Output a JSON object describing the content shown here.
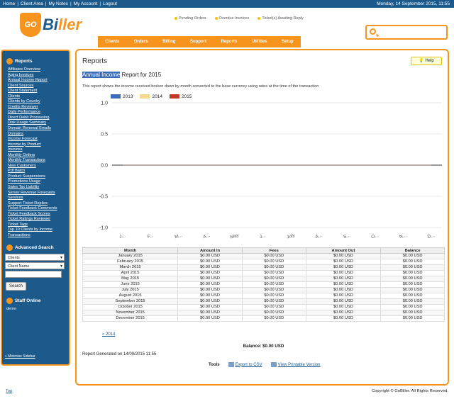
{
  "topbar": {
    "links": [
      "Home",
      "Client Area",
      "My Notes",
      "My Account",
      "Logout"
    ],
    "date": "Monday, 14 September 2015, 11:55"
  },
  "logo": {
    "badge": "GO",
    "name_a": "Bi",
    "name_b": "ller"
  },
  "alerts": [
    "Pending Orders",
    "Overdue Invoices",
    "Ticket(s) Awaiting Reply"
  ],
  "nav": [
    "Clients",
    "Orders",
    "Billing",
    "Support",
    "Reports",
    "Utilities",
    "Setup"
  ],
  "sidebar": {
    "reports_title": "Reports",
    "reports": [
      "Affiliates Overview",
      "Aging Invoices",
      "Annual Income Report",
      "Client Sources",
      "Client Statement",
      "Clients",
      "Clients by Country",
      "Credits Reviewer",
      "Daily Performance",
      "Direct Debit Processing",
      "Disk Usage Summary",
      "Domain Renewal Emails",
      "Domains",
      "Income Forecast",
      "Income by Product",
      "Invoices",
      "Monthly Orders",
      "Monthly Transactions",
      "New Customers",
      "Pdf Batch",
      "Product Suspensions",
      "Promotions Usage",
      "Sales Tax Liability",
      "Server Revenue Forecasts",
      "Services",
      "Support Ticket Replies",
      "Ticket Feedback Comments",
      "Ticket Feedback Scores",
      "Ticket Ratings Reviewer",
      "Ticket Tags",
      "Top 10 Clients by Income",
      "Transactions"
    ],
    "adv_title": "Advanced Search",
    "select1": "Clients",
    "select2": "Client Name",
    "search_btn": "Search",
    "staff_title": "Staff Online",
    "staff": "demo",
    "minimize": "« Minimise Sidebar"
  },
  "main": {
    "title": "Reports",
    "help": "Help",
    "subtitle_hl": "Annual Income",
    "subtitle_rest": " Report for 2015",
    "description": "This report shows the income received broken down by month converted to the base currency using rates at the time of the transaction",
    "legend": [
      {
        "label": "2013",
        "color": "#3a6db5"
      },
      {
        "label": "2014",
        "color": "#f6d98b"
      },
      {
        "label": "2015",
        "color": "#c0392b"
      }
    ],
    "table": {
      "headers": [
        "Month",
        "Amount In",
        "Fees",
        "Amount Out",
        "Balance"
      ],
      "rows": [
        [
          "January 2015",
          "$0.00 USD",
          "$0.00 USD",
          "$0.00 USD",
          "$0.00 USD"
        ],
        [
          "February 2015",
          "$0.00 USD",
          "$0.00 USD",
          "$0.00 USD",
          "$0.00 USD"
        ],
        [
          "March 2015",
          "$0.00 USD",
          "$0.00 USD",
          "$0.00 USD",
          "$0.00 USD"
        ],
        [
          "April 2015",
          "$0.00 USD",
          "$0.00 USD",
          "$0.00 USD",
          "$0.00 USD"
        ],
        [
          "May 2015",
          "$0.00 USD",
          "$0.00 USD",
          "$0.00 USD",
          "$0.00 USD"
        ],
        [
          "June 2015",
          "$0.00 USD",
          "$0.00 USD",
          "$0.00 USD",
          "$0.00 USD"
        ],
        [
          "July 2015",
          "$0.00 USD",
          "$0.00 USD",
          "$0.00 USD",
          "$0.00 USD"
        ],
        [
          "August 2015",
          "$0.00 USD",
          "$0.00 USD",
          "$0.00 USD",
          "$0.00 USD"
        ],
        [
          "September 2015",
          "$0.00 USD",
          "$0.00 USD",
          "$0.00 USD",
          "$0.00 USD"
        ],
        [
          "October 2015",
          "$0.00 USD",
          "$0.00 USD",
          "$0.00 USD",
          "$0.00 USD"
        ],
        [
          "November 2015",
          "$0.00 USD",
          "$0.00 USD",
          "$0.00 USD",
          "$0.00 USD"
        ],
        [
          "December 2015",
          "$0.00 USD",
          "$0.00 USD",
          "$0.00 USD",
          "$0.00 USD"
        ]
      ]
    },
    "prev": "« 2014",
    "balance": "Balance: $0.00 USD",
    "generated": "Report Generated on 14/09/2015 11:55",
    "tools_label": "Tools",
    "export": "Export to CSV",
    "printable": "View Printable Version"
  },
  "chart_data": {
    "type": "line",
    "categories": [
      "J...",
      "F...",
      "M...",
      "A...",
      "May",
      "J...",
      "July",
      "A...",
      "S...",
      "O...",
      "N...",
      "D..."
    ],
    "ylim": [
      -1.0,
      1.0
    ],
    "yticks": [
      "1.0",
      "0.5",
      "0.0",
      "-0.5",
      "-1.0"
    ],
    "grid": true,
    "legend_position": "top-left",
    "series": [
      {
        "name": "2013",
        "values": [
          0,
          0,
          0,
          0,
          0,
          0,
          0,
          0,
          0,
          0,
          0,
          0
        ]
      },
      {
        "name": "2014",
        "values": [
          0,
          0,
          0,
          0,
          0,
          0,
          0,
          0,
          0,
          0,
          0,
          0
        ]
      },
      {
        "name": "2015",
        "values": [
          0,
          0,
          0,
          0,
          0,
          0,
          0,
          0,
          0,
          0,
          0,
          0
        ]
      }
    ]
  },
  "footer": {
    "top": "Top",
    "copyright": "Copyright © GoBiller. All Rights Reserved."
  }
}
